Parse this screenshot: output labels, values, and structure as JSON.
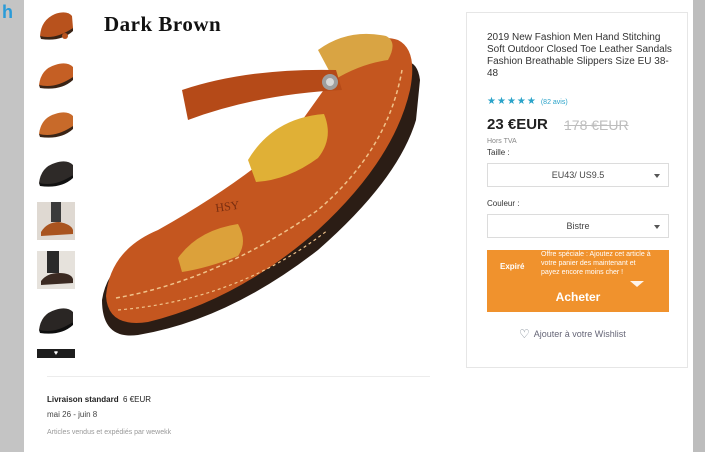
{
  "background": {
    "logo_fragment": "h"
  },
  "gallery": {
    "caption": "Dark Brown",
    "thumbnails": [
      "Dark Brown",
      "Light Brown",
      "Light Brown",
      "Black",
      "Khaki",
      "Black",
      "Black"
    ],
    "more_icon": "heart-icon"
  },
  "product": {
    "title": "2019 New Fashion Men Hand Stitching Soft Outdoor Closed Toe Leather Sandals Fashion Breathable Slippers Size EU 38-48",
    "stars": 4.5,
    "reviews": "(82 avis)",
    "price": "23 €EUR",
    "old_price": "178 €EUR",
    "tax_note": "Hors TVA",
    "size_label": "Taille :",
    "size_value": "EU43/ US9.5",
    "color_label": "Couleur :",
    "color_value": "Bistre",
    "offer_status": "Expiré",
    "offer_text": "Offre spéciale : Ajoutez cet article à votre panier des maintenant et payez encore moins cher !",
    "buy_label": "Acheter",
    "wishlist_label": "Ajouter à votre Wishlist"
  },
  "shipping": {
    "method": "Livraison standard",
    "cost": "6 €EUR",
    "dates": "mai 26 - juin 8",
    "seller": "Articles vendus et expédiés par wewekk"
  },
  "colors": {
    "accent": "#f0922d",
    "star": "#2aa3c9",
    "leather": "#c4561f"
  }
}
